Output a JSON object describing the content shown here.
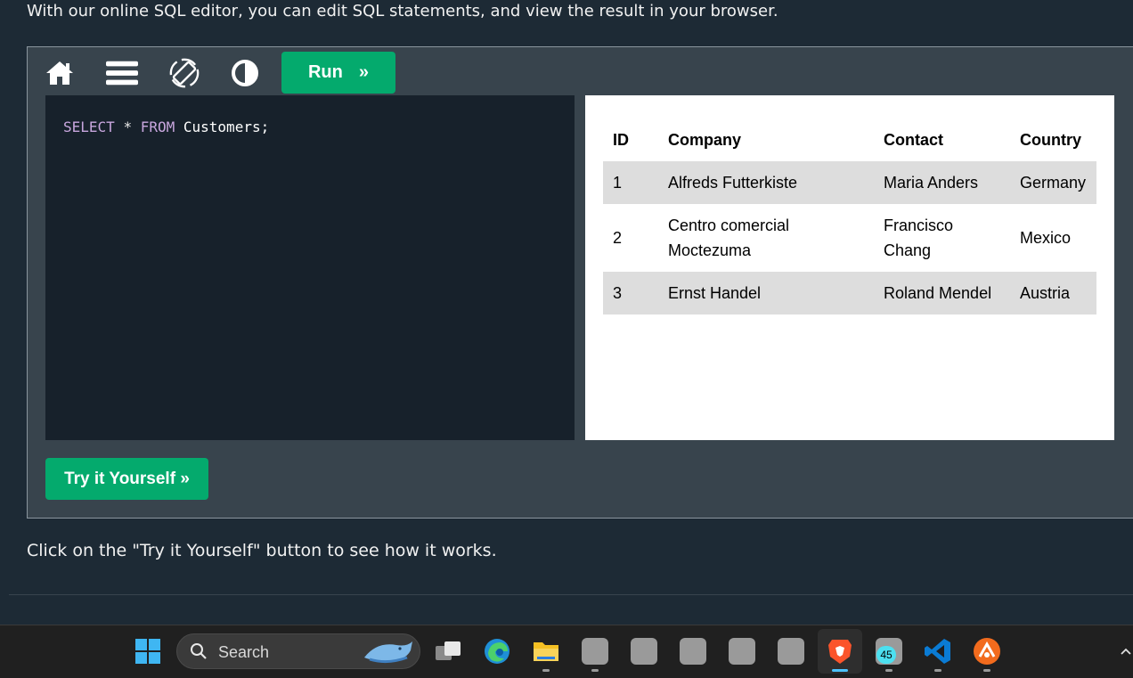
{
  "intro_text": "With our online SQL editor, you can edit SQL statements, and view the result in your browser.",
  "toolbar": {
    "icons": [
      "home-icon",
      "menu-icon",
      "rotate-icon",
      "contrast-icon"
    ],
    "run_label": "Run",
    "run_arrow": "»"
  },
  "editor": {
    "kw1": "SELECT",
    "star": "*",
    "kw2": "FROM",
    "table": "Customers;"
  },
  "result": {
    "headers": [
      "ID",
      "Company",
      "Contact",
      "Country"
    ],
    "rows": [
      [
        "1",
        "Alfreds Futterkiste",
        "Maria Anders",
        "Germany"
      ],
      [
        "2",
        "Centro comercial Moctezuma",
        "Francisco Chang",
        "Mexico"
      ],
      [
        "3",
        "Ernst Handel",
        "Roland Mendel",
        "Austria"
      ]
    ]
  },
  "try_button": "Try it Yourself »",
  "outro_text": "Click on the \"Try it Yourself\" button to see how it works.",
  "taskbar": {
    "search_label": "Search",
    "badge_count": "45",
    "colors": {
      "accent": "#04aa6d",
      "editor_bg": "#17212b",
      "page_bg": "#1d2a35"
    }
  }
}
